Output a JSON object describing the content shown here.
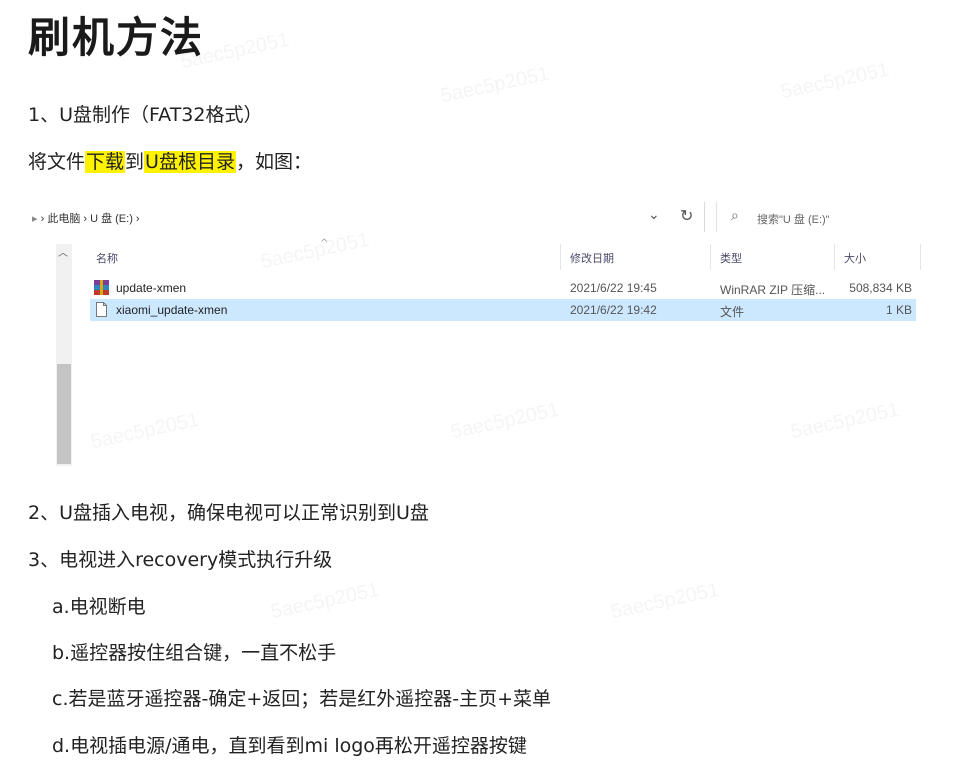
{
  "doc": {
    "title": "刷机方法",
    "step1": "1、U盘制作（FAT32格式）",
    "copy_line": {
      "prefix": "将文件",
      "hl1": "下载",
      "mid": "到",
      "hl2": "U盘根目录",
      "suffix": "，如图："
    },
    "step2": "2、U盘插入电视，确保电视可以正常识别到U盘",
    "step3": "3、电视进入recovery模式执行升级",
    "sub_a": "a.电视断电",
    "sub_b": "b.遥控器按住组合键，一直不松手",
    "sub_c": "c.若是蓝牙遥控器-确定+返回；若是红外遥控器-主页+菜单",
    "sub_d": "d.电视插电源/通电，直到看到mi logo再松开遥控器按键"
  },
  "explorer": {
    "breadcrumb": "› 此电脑 › U 盘 (E:) ›",
    "search_placeholder": "搜索\"U 盘 (E:)\"",
    "columns": {
      "name": "名称",
      "date": "修改日期",
      "type": "类型",
      "size": "大小"
    },
    "files": [
      {
        "name": "update-xmen",
        "date": "2021/6/22 19:45",
        "type": "WinRAR ZIP 压缩...",
        "size": "508,834 KB",
        "icon": "winrar-zip-icon"
      },
      {
        "name": "xiaomi_update-xmen",
        "date": "2021/6/22 19:42",
        "type": "文件",
        "size": "1 KB",
        "icon": "blank-file-icon"
      }
    ]
  },
  "watermark": "5aec5p2051",
  "colors": {
    "highlight": "#fff200",
    "selection": "#cce8ff"
  }
}
